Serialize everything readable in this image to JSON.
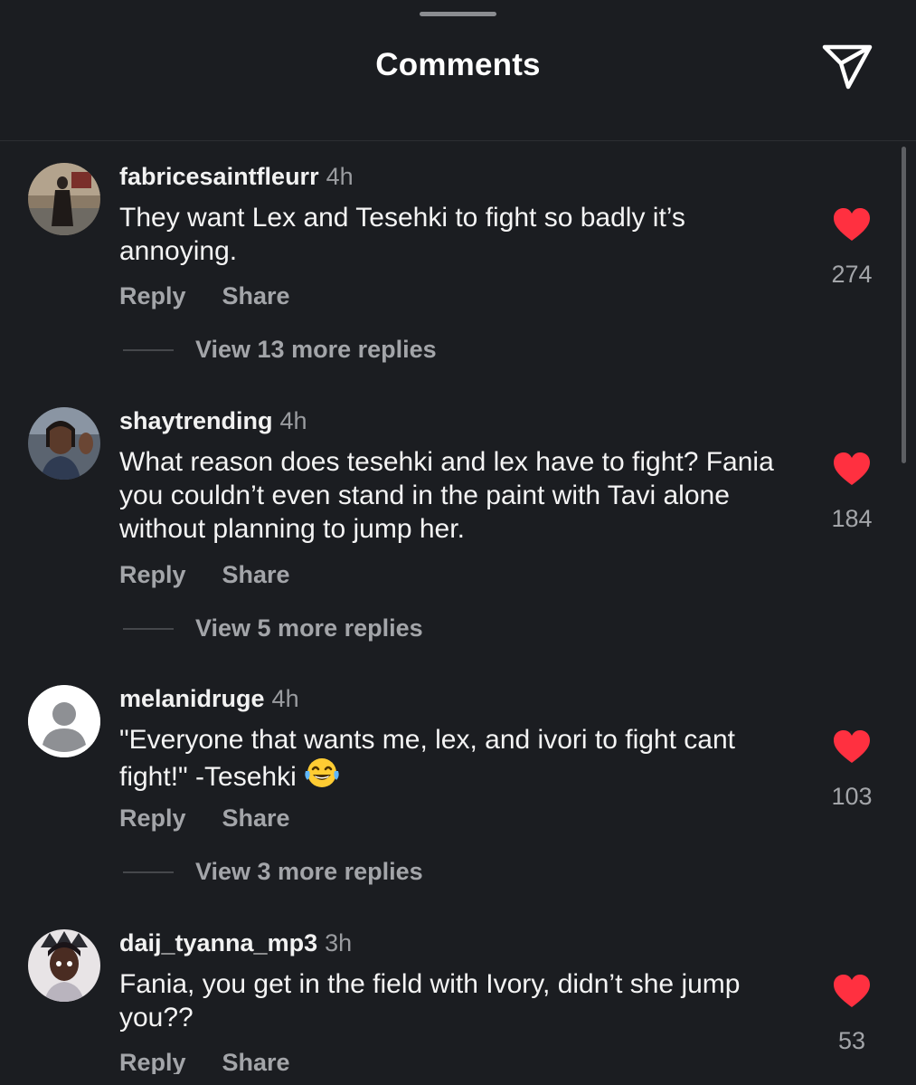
{
  "header": {
    "title": "Comments",
    "share_icon": "paper-plane-icon"
  },
  "colors": {
    "background": "#1b1d21",
    "like_red": "#ff3040",
    "muted": "#a3a5a9"
  },
  "comments": [
    {
      "username": "fabricesaintfleurr",
      "time": "4h",
      "text": "They want Lex and Tesehki to fight so badly it’s annoying.",
      "reply_label": "Reply",
      "share_label": "Share",
      "view_replies": "View 13 more replies",
      "likes": "274",
      "avatar_icon": "photo-avatar-icon"
    },
    {
      "username": "shaytrending",
      "time": "4h",
      "text": "What reason does tesehki and lex have to fight? Fania you couldn’t even stand in the paint with Tavi alone without planning to jump her.",
      "reply_label": "Reply",
      "share_label": "Share",
      "view_replies": "View 5 more replies",
      "likes": "184",
      "avatar_icon": "photo-avatar-icon"
    },
    {
      "username": "melanidruge",
      "time": "4h",
      "text": "\"Everyone that wants me, lex, and ivori to fight cant fight!\" -Tesehki",
      "emoji": "tears-of-joy-emoji",
      "reply_label": "Reply",
      "share_label": "Share",
      "view_replies": "View 3 more replies",
      "likes": "103",
      "avatar_icon": "default-avatar-icon"
    },
    {
      "username": "daij_tyanna_mp3",
      "time": "3h",
      "text": "Fania, you get in the field with Ivory, didn’t she jump you??",
      "reply_label": "Reply",
      "share_label": "Share",
      "likes": "53",
      "avatar_icon": "photo-avatar-icon"
    }
  ]
}
